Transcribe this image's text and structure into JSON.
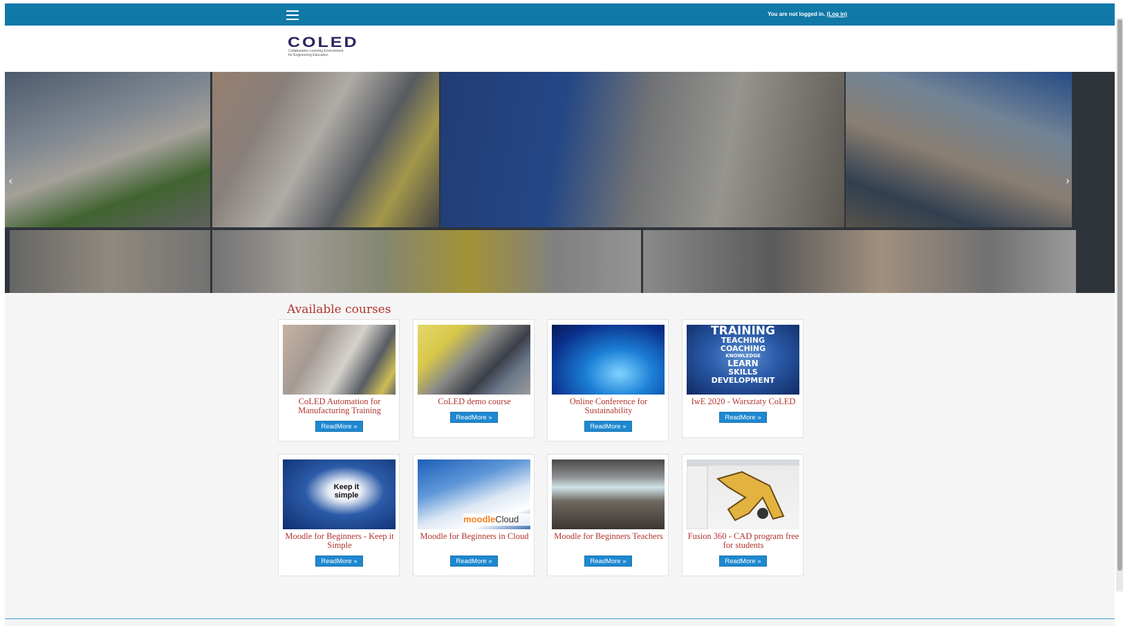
{
  "navbar": {
    "login_text": "You are not logged in.",
    "login_link": "(Log in)",
    "menu_icon": "hamburger-icon",
    "bg_color": "#1179a8"
  },
  "logo": {
    "text": "COLED",
    "subtitle_line1": "Collaborative Learning Environment",
    "subtitle_line2": "for Engineering Education"
  },
  "slider": {
    "prev_icon": "chevron-left-icon",
    "next_icon": "chevron-right-icon",
    "prev_glyph": "‹",
    "next_glyph": "›"
  },
  "courses": {
    "title": "Available courses",
    "readmore_label": "ReadMore",
    "readmore_icon": "double-chevron-right-icon",
    "readmore_glyph": "»",
    "items": [
      {
        "name": "CoLED Automation for Manufacturing Training",
        "image": "lab-students-photo"
      },
      {
        "name": "CoLED demo course",
        "image": "machine-photo"
      },
      {
        "name": "Online Conference for Sustainability",
        "image": "devices-photo"
      },
      {
        "name": "IwE 2020 - Warsztaty CoLED",
        "image": "training-words-photo"
      },
      {
        "name": "Moodle for Beginners - Keep it Simple",
        "image": "keep-it-simple-cloud"
      },
      {
        "name": "Moodle for Beginners in Cloud",
        "image": "moodlecloud-photo"
      },
      {
        "name": "Moodle for Beginners Teachers",
        "image": "lecture-hall-photo"
      },
      {
        "name": "Fusion 360 - CAD program free for students",
        "image": "cad-screenshot"
      }
    ],
    "thumb_texts": {
      "keep_it": "Keep it",
      "simple": "simple",
      "moodle": "moodle",
      "cloud": "Cloud",
      "training_words": [
        "TRAINING",
        "TEACHING",
        "COACHING",
        "KNOWLEDGE",
        "LEARN",
        "SKILLS",
        "DEVELOPMENT"
      ]
    },
    "title_color": "#b0342e",
    "button_color": "#1e88d0"
  }
}
